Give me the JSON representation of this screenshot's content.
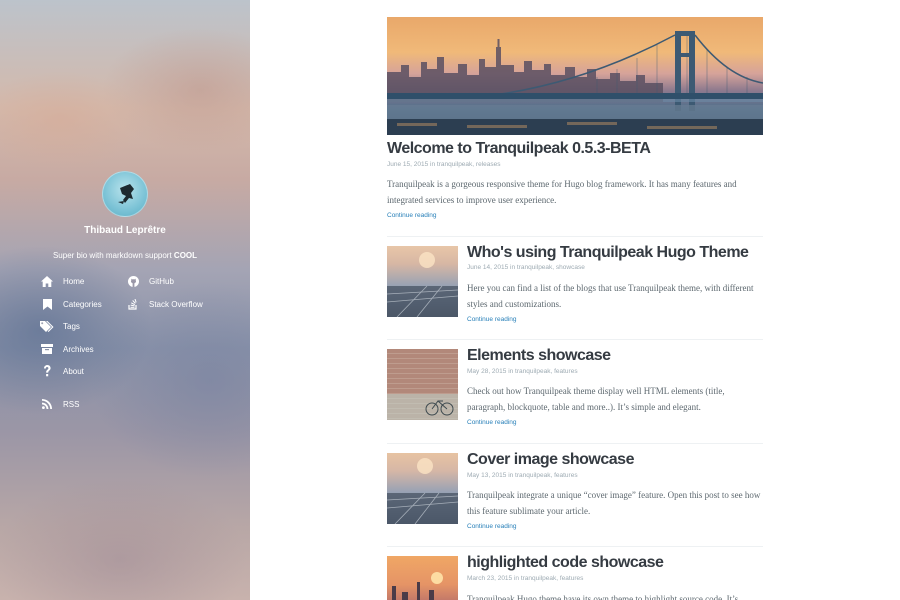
{
  "sidebar": {
    "author_name": "Thibaud Leprêtre",
    "bio_prefix": "Super bio with markdown support",
    "bio_emphasis": "COOL",
    "nav": [
      {
        "label": "Home",
        "icon": "home-icon"
      },
      {
        "label": "Categories",
        "icon": "bookmark-icon"
      },
      {
        "label": "Tags",
        "icon": "tags-icon"
      },
      {
        "label": "Archives",
        "icon": "archive-icon"
      },
      {
        "label": "About",
        "icon": "question-icon"
      }
    ],
    "social": [
      {
        "label": "GitHub",
        "icon": "github-icon"
      },
      {
        "label": "Stack Overflow",
        "icon": "stackoverflow-icon"
      }
    ],
    "rss": {
      "label": "RSS",
      "icon": "rss-icon"
    }
  },
  "posts": [
    {
      "title": "Welcome to Tranquilpeak 0.5.3-BETA",
      "meta": "June 15, 2015 in tranquilpeak, releases",
      "excerpt": "Tranquilpeak is a gorgeous responsive theme for Hugo blog framework. It has many features and integrated services to improve user experience.",
      "read_more": "Continue reading"
    },
    {
      "title": "Who's using Tranquilpeak Hugo Theme",
      "meta": "June 14, 2015 in tranquilpeak, showcase",
      "excerpt": "Here you can find a list of the blogs that use Tranquilpeak theme, with different styles and customizations.",
      "read_more": "Continue reading"
    },
    {
      "title": "Elements showcase",
      "meta": "May 28, 2015 in tranquilpeak, features",
      "excerpt": "Check out how Tranquilpeak theme display well HTML elements (title, paragraph, blockquote, table and more..). It’s simple and elegant.",
      "read_more": "Continue reading"
    },
    {
      "title": "Cover image showcase",
      "meta": "May 13, 2015 in tranquilpeak, features",
      "excerpt": "Tranquilpeak integrate a unique “cover image” feature. Open this post to see how this feature sublimate your article.",
      "read_more": "Continue reading"
    },
    {
      "title": "highlighted code showcase",
      "meta": "March 23, 2015 in tranquilpeak, features",
      "excerpt": "Tranquilpeak Hugo theme have its own theme to highlight source code. It’s",
      "read_more": ""
    }
  ],
  "colors": {
    "title": "#353b42",
    "meta": "#9eabb3",
    "link": "#2980b9",
    "text": "#5d686f"
  }
}
